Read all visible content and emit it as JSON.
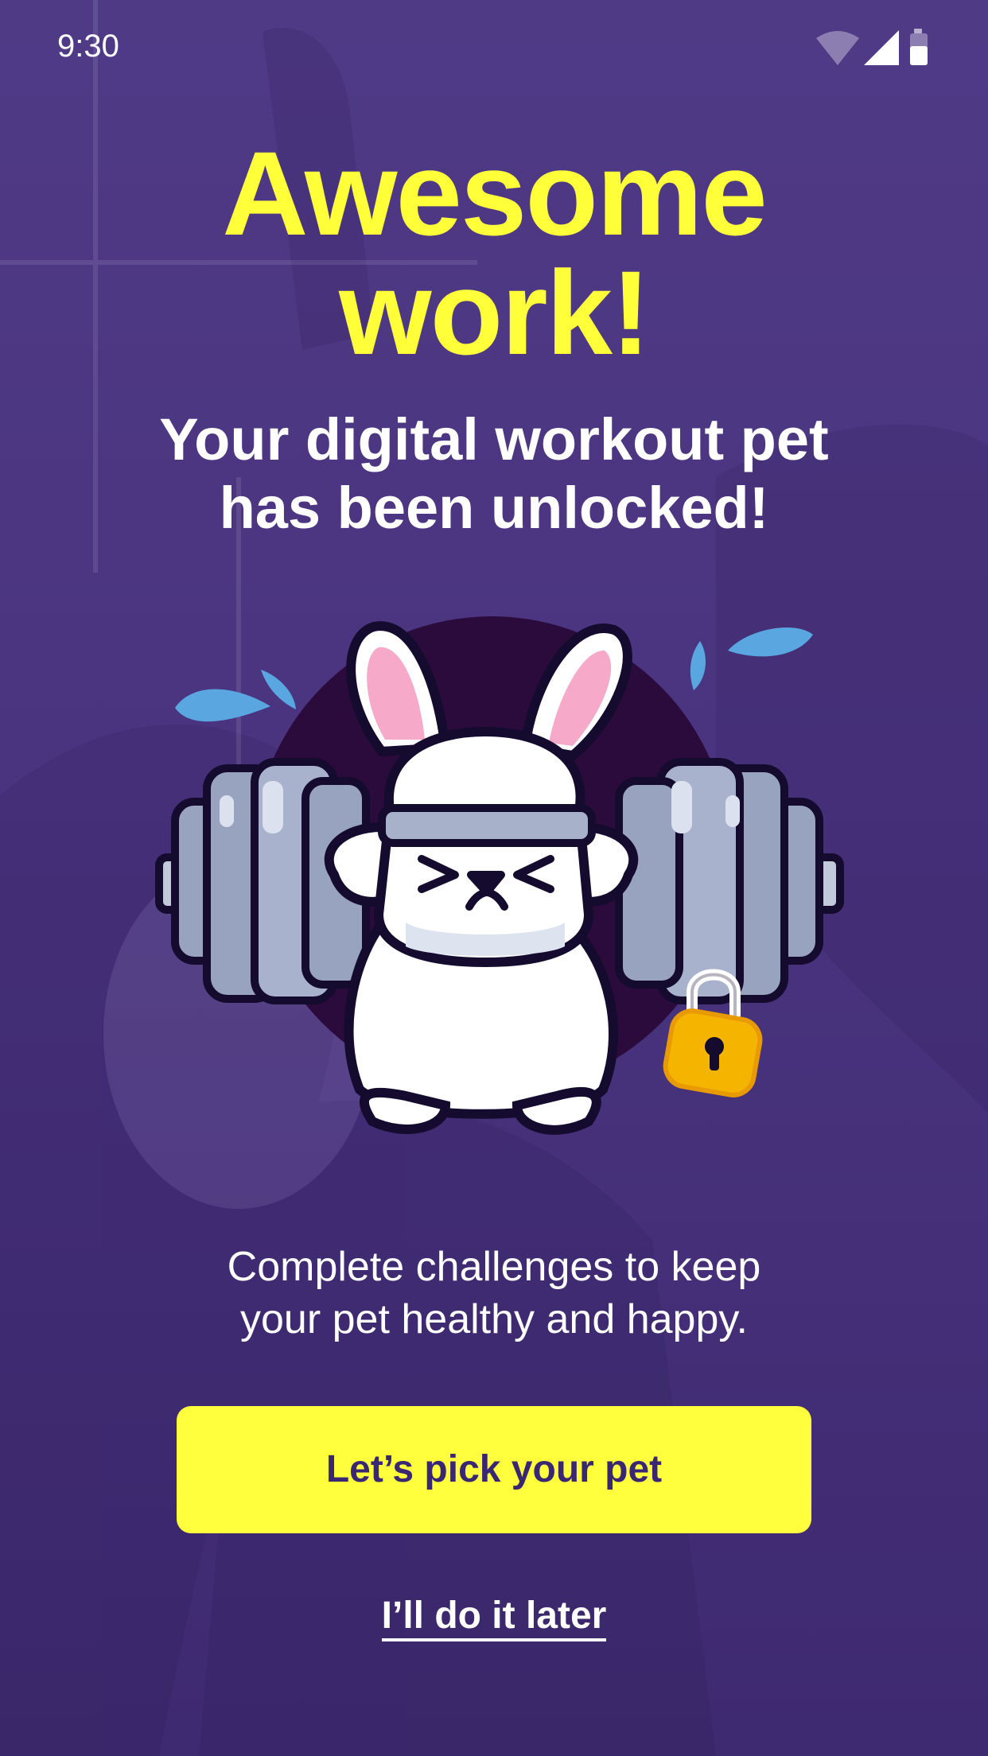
{
  "status_bar": {
    "time": "9:30",
    "icons": [
      "wifi-icon",
      "signal-icon",
      "battery-icon"
    ]
  },
  "hero": {
    "headline_line1": "Awesome",
    "headline_line2": "work!",
    "subheadline_line1": "Your digital workout pet",
    "subheadline_line2": "has been unlocked!"
  },
  "illustration": {
    "subject": "bunny-lifting-barbell",
    "badge_icon": "padlock-unlocked-icon"
  },
  "body": {
    "description_line1": "Complete challenges to keep",
    "description_line2": "your pet healthy and happy."
  },
  "actions": {
    "primary_label": "Let’s pick your pet",
    "secondary_label": "I’ll do it later"
  },
  "colors": {
    "background": "#4a3480",
    "accent_yellow": "#ffff3a",
    "button_text": "#3a2773",
    "text_white": "#ffffff"
  }
}
